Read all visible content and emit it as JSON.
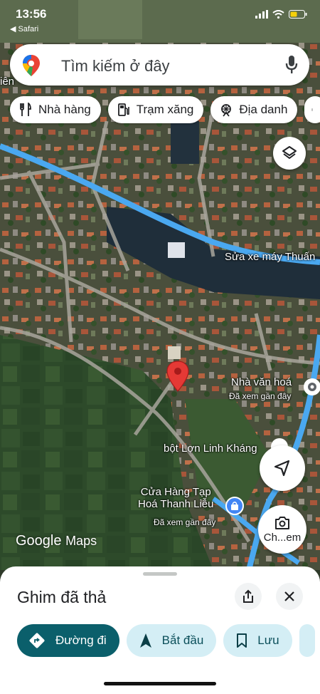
{
  "status_bar": {
    "time": "13:56",
    "back_app": "◀ Safari"
  },
  "search": {
    "placeholder": "Tìm kiếm ở đây"
  },
  "chips": [
    {
      "label": "Nhà hàng",
      "icon": "restaurant-icon"
    },
    {
      "label": "Trạm xăng",
      "icon": "gas-station-icon"
    },
    {
      "label": "Địa danh",
      "icon": "landmark-icon"
    }
  ],
  "map_labels": {
    "edge_text": "iên",
    "repair_shop": "Sửa xe máy Thuấn",
    "cultural_house": "Nhà văn hoá",
    "cultural_house_sub": "Đã xem gần đây",
    "flour_shop": "bột Lợn Linh Kháng",
    "grocery_line1": "Cửa Hàng Tạp",
    "grocery_line2": "Hoá Thanh Liễu",
    "grocery_sub": "Đã xem gần đây",
    "photo_button": "Ch...em"
  },
  "watermark": {
    "brand": "Google",
    "product": "Maps"
  },
  "sheet": {
    "title": "Ghim đã thả",
    "actions": [
      {
        "label": "Đường đi",
        "icon": "directions-icon"
      },
      {
        "label": "Bắt đầu",
        "icon": "navigation-arrow-icon"
      },
      {
        "label": "Lưu",
        "icon": "bookmark-icon"
      }
    ]
  },
  "colors": {
    "route": "#4aa8f0",
    "pin": "#e53935",
    "primary": "#0b5f6b",
    "secondary": "#d4eef5"
  }
}
